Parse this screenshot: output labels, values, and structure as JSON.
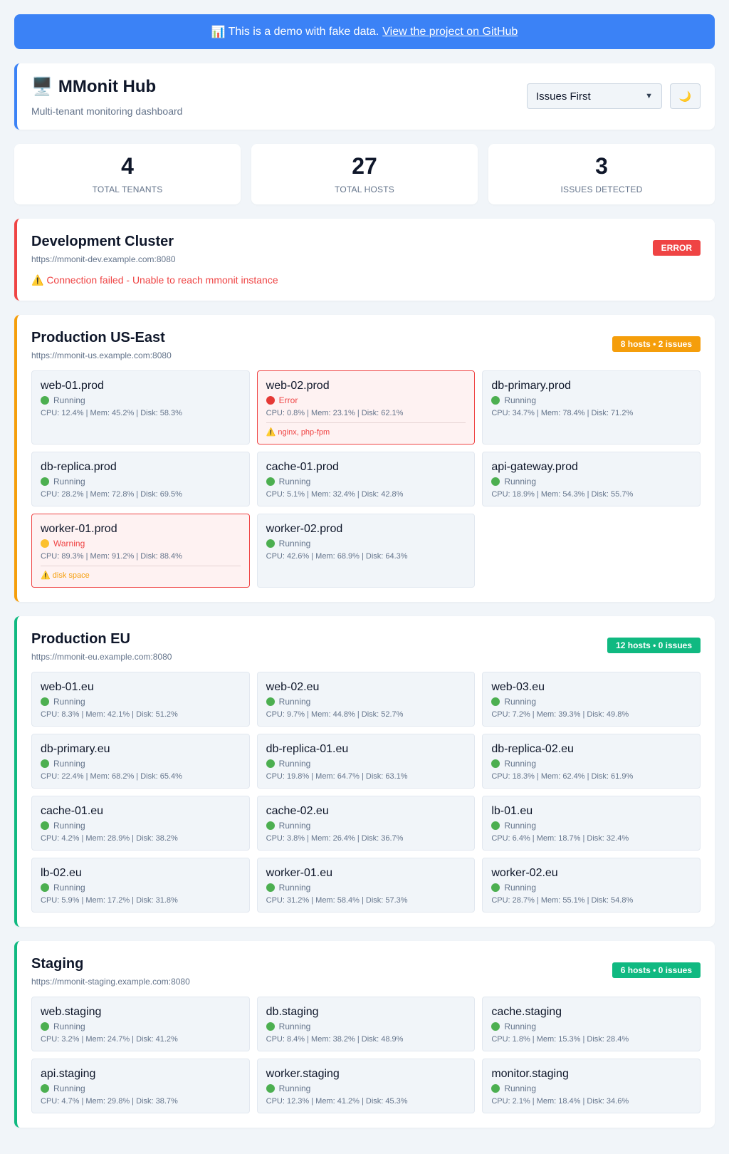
{
  "banner": {
    "icon": "📊",
    "text": "This is a demo with fake data.",
    "link_text": "View the project on GitHub"
  },
  "header": {
    "icon": "🖥️",
    "title": "MMonit Hub",
    "subtitle": "Multi-tenant monitoring dashboard",
    "sort_value": "Issues First",
    "theme_icon": "🌙"
  },
  "stats": [
    {
      "value": "4",
      "label": "Total Tenants"
    },
    {
      "value": "27",
      "label": "Total Hosts"
    },
    {
      "value": "3",
      "label": "Issues Detected"
    }
  ],
  "colors": {
    "accent": "#3b82f6",
    "error": "#ef4444",
    "warning": "#f59e0b",
    "ok": "#10b981"
  },
  "tenants": [
    {
      "name": "Development Cluster",
      "url": "https://mmonit-dev.example.com:8080",
      "badge": "ERROR",
      "state": "error",
      "error": "⚠️ Connection failed - Unable to reach mmonit instance",
      "hosts": []
    },
    {
      "name": "Production US-East",
      "url": "https://mmonit-us.example.com:8080",
      "badge": "8 hosts • 2 issues",
      "state": "warn",
      "hosts": [
        {
          "name": "web-01.prod",
          "status": "Running",
          "state": "ok",
          "metrics": "CPU: 12.4% | Mem: 45.2% | Disk: 58.3%"
        },
        {
          "name": "web-02.prod",
          "status": "Error",
          "state": "error",
          "metrics": "CPU: 0.8% | Mem: 23.1% | Disk: 62.1%",
          "issues": "⚠️ nginx, php-fpm"
        },
        {
          "name": "db-primary.prod",
          "status": "Running",
          "state": "ok",
          "metrics": "CPU: 34.7% | Mem: 78.4% | Disk: 71.2%"
        },
        {
          "name": "db-replica.prod",
          "status": "Running",
          "state": "ok",
          "metrics": "CPU: 28.2% | Mem: 72.8% | Disk: 69.5%"
        },
        {
          "name": "cache-01.prod",
          "status": "Running",
          "state": "ok",
          "metrics": "CPU: 5.1% | Mem: 32.4% | Disk: 42.8%"
        },
        {
          "name": "api-gateway.prod",
          "status": "Running",
          "state": "ok",
          "metrics": "CPU: 18.9% | Mem: 54.3% | Disk: 55.7%"
        },
        {
          "name": "worker-01.prod",
          "status": "Warning",
          "state": "warn",
          "metrics": "CPU: 89.3% | Mem: 91.2% | Disk: 88.4%",
          "issues": "⚠️ disk space"
        },
        {
          "name": "worker-02.prod",
          "status": "Running",
          "state": "ok",
          "metrics": "CPU: 42.6% | Mem: 68.9% | Disk: 64.3%"
        }
      ]
    },
    {
      "name": "Production EU",
      "url": "https://mmonit-eu.example.com:8080",
      "badge": "12 hosts • 0 issues",
      "state": "ok",
      "hosts": [
        {
          "name": "web-01.eu",
          "status": "Running",
          "state": "ok",
          "metrics": "CPU: 8.3% | Mem: 42.1% | Disk: 51.2%"
        },
        {
          "name": "web-02.eu",
          "status": "Running",
          "state": "ok",
          "metrics": "CPU: 9.7% | Mem: 44.8% | Disk: 52.7%"
        },
        {
          "name": "web-03.eu",
          "status": "Running",
          "state": "ok",
          "metrics": "CPU: 7.2% | Mem: 39.3% | Disk: 49.8%"
        },
        {
          "name": "db-primary.eu",
          "status": "Running",
          "state": "ok",
          "metrics": "CPU: 22.4% | Mem: 68.2% | Disk: 65.4%"
        },
        {
          "name": "db-replica-01.eu",
          "status": "Running",
          "state": "ok",
          "metrics": "CPU: 19.8% | Mem: 64.7% | Disk: 63.1%"
        },
        {
          "name": "db-replica-02.eu",
          "status": "Running",
          "state": "ok",
          "metrics": "CPU: 18.3% | Mem: 62.4% | Disk: 61.9%"
        },
        {
          "name": "cache-01.eu",
          "status": "Running",
          "state": "ok",
          "metrics": "CPU: 4.2% | Mem: 28.9% | Disk: 38.2%"
        },
        {
          "name": "cache-02.eu",
          "status": "Running",
          "state": "ok",
          "metrics": "CPU: 3.8% | Mem: 26.4% | Disk: 36.7%"
        },
        {
          "name": "lb-01.eu",
          "status": "Running",
          "state": "ok",
          "metrics": "CPU: 6.4% | Mem: 18.7% | Disk: 32.4%"
        },
        {
          "name": "lb-02.eu",
          "status": "Running",
          "state": "ok",
          "metrics": "CPU: 5.9% | Mem: 17.2% | Disk: 31.8%"
        },
        {
          "name": "worker-01.eu",
          "status": "Running",
          "state": "ok",
          "metrics": "CPU: 31.2% | Mem: 58.4% | Disk: 57.3%"
        },
        {
          "name": "worker-02.eu",
          "status": "Running",
          "state": "ok",
          "metrics": "CPU: 28.7% | Mem: 55.1% | Disk: 54.8%"
        }
      ]
    },
    {
      "name": "Staging",
      "url": "https://mmonit-staging.example.com:8080",
      "badge": "6 hosts • 0 issues",
      "state": "ok",
      "hosts": [
        {
          "name": "web.staging",
          "status": "Running",
          "state": "ok",
          "metrics": "CPU: 3.2% | Mem: 24.7% | Disk: 41.2%"
        },
        {
          "name": "db.staging",
          "status": "Running",
          "state": "ok",
          "metrics": "CPU: 8.4% | Mem: 38.2% | Disk: 48.9%"
        },
        {
          "name": "cache.staging",
          "status": "Running",
          "state": "ok",
          "metrics": "CPU: 1.8% | Mem: 15.3% | Disk: 28.4%"
        },
        {
          "name": "api.staging",
          "status": "Running",
          "state": "ok",
          "metrics": "CPU: 4.7% | Mem: 29.8% | Disk: 38.7%"
        },
        {
          "name": "worker.staging",
          "status": "Running",
          "state": "ok",
          "metrics": "CPU: 12.3% | Mem: 41.2% | Disk: 45.3%"
        },
        {
          "name": "monitor.staging",
          "status": "Running",
          "state": "ok",
          "metrics": "CPU: 2.1% | Mem: 18.4% | Disk: 34.6%"
        }
      ]
    }
  ]
}
